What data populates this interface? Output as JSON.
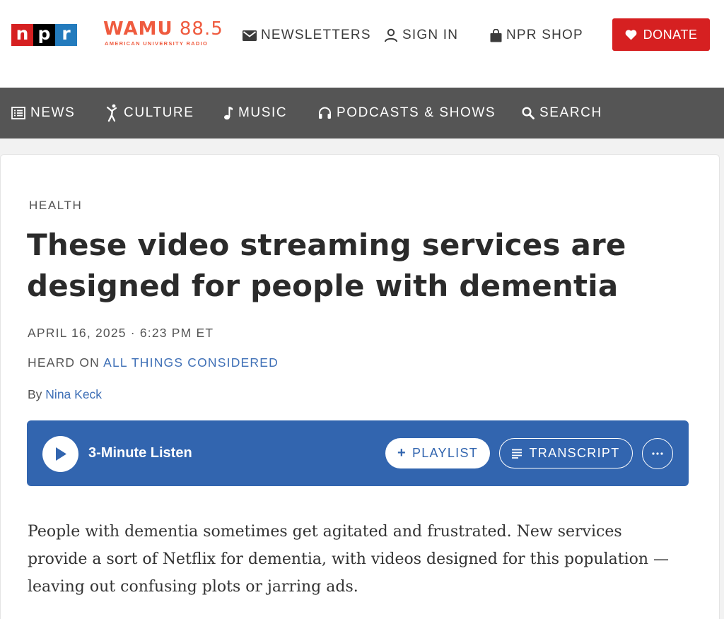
{
  "header": {
    "npr_logo": [
      "n",
      "p",
      "r"
    ],
    "station": {
      "name": "WAMU",
      "frequency": "88.5",
      "tagline": "AMERICAN UNIVERSITY RADIO"
    },
    "links": [
      {
        "label": "NEWSLETTERS",
        "icon": "envelope-icon"
      },
      {
        "label": "SIGN IN",
        "icon": "user-icon"
      },
      {
        "label": "NPR SHOP",
        "icon": "shopping-bag-icon"
      }
    ],
    "donate": {
      "label": "DONATE",
      "icon": "heart-icon"
    }
  },
  "nav": {
    "items": [
      {
        "label": "NEWS",
        "icon": "news-icon"
      },
      {
        "label": "CULTURE",
        "icon": "culture-figure-icon"
      },
      {
        "label": "MUSIC",
        "icon": "music-note-icon"
      },
      {
        "label": "PODCASTS & SHOWS",
        "icon": "headphones-icon"
      },
      {
        "label": "SEARCH",
        "icon": "search-icon"
      }
    ]
  },
  "article": {
    "slug": "HEALTH",
    "headline": "These video streaming services are designed for people with dementia",
    "date": "APRIL 16, 2025 · 6:23 PM ET",
    "heard_on_prefix": "HEARD ON ",
    "heard_on_program": "ALL THINGS CONSIDERED",
    "byline_prefix": "By ",
    "author": "Nina Keck",
    "teaser": "People with dementia sometimes get agitated and frustrated. New services provide a sort of Netflix for dementia, with videos designed for this population — leaving out confusing plots or jarring ads."
  },
  "player": {
    "duration_label": "3-Minute Listen",
    "playlist_label": "PLAYLIST",
    "transcript_label": "TRANSCRIPT",
    "more_label": "···"
  },
  "colors": {
    "npr_red": "#d62021",
    "npr_black": "#000000",
    "npr_blue": "#237bbd",
    "wamu_orange": "#ef5b3f",
    "nav_bg": "#555555",
    "link_blue": "#3e6fb6",
    "player_blue": "#3265af",
    "donate_red": "#d62021"
  }
}
